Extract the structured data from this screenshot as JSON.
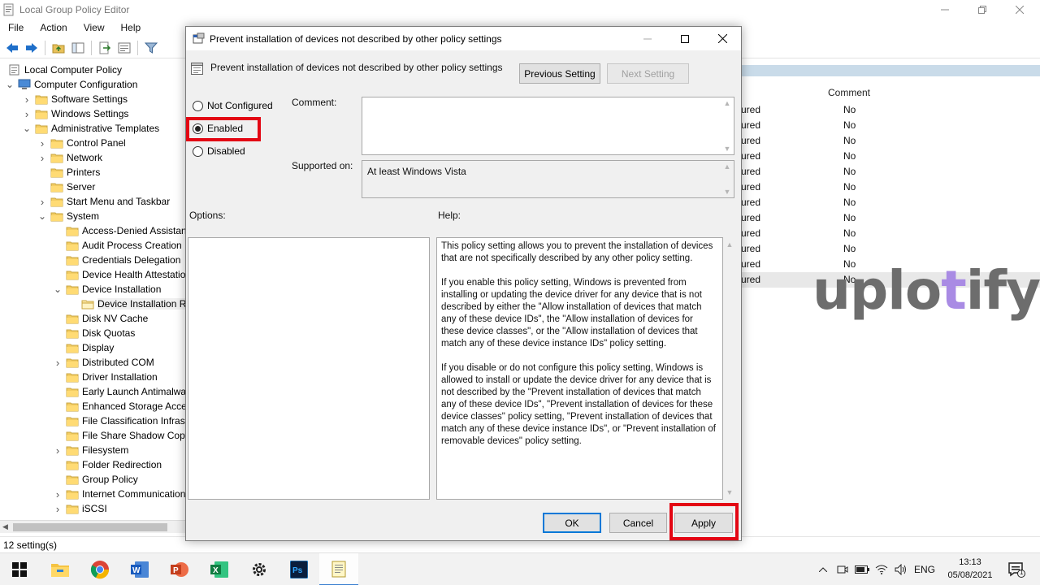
{
  "main": {
    "title": "Local Group Policy Editor",
    "menu": [
      "File",
      "Action",
      "View",
      "Help"
    ],
    "tree": [
      {
        "label": "Local Computer Policy",
        "level": 0,
        "expander": "",
        "folder": false
      },
      {
        "label": "Computer Configuration",
        "level": 0,
        "expander": "open",
        "folder": false
      },
      {
        "label": "Software Settings",
        "level": 1,
        "expander": "closed",
        "folder": true
      },
      {
        "label": "Windows Settings",
        "level": 1,
        "expander": "closed",
        "folder": true
      },
      {
        "label": "Administrative Templates",
        "level": 1,
        "expander": "open",
        "folder": true
      },
      {
        "label": "Control Panel",
        "level": 2,
        "expander": "closed",
        "folder": true
      },
      {
        "label": "Network",
        "level": 2,
        "expander": "closed",
        "folder": true
      },
      {
        "label": "Printers",
        "level": 2,
        "expander": "",
        "folder": true
      },
      {
        "label": "Server",
        "level": 2,
        "expander": "",
        "folder": true
      },
      {
        "label": "Start Menu and Taskbar",
        "level": 2,
        "expander": "closed",
        "folder": true
      },
      {
        "label": "System",
        "level": 2,
        "expander": "open",
        "folder": true
      },
      {
        "label": "Access-Denied Assistance",
        "level": 3,
        "expander": "",
        "folder": true
      },
      {
        "label": "Audit Process Creation",
        "level": 3,
        "expander": "",
        "folder": true
      },
      {
        "label": "Credentials Delegation",
        "level": 3,
        "expander": "",
        "folder": true
      },
      {
        "label": "Device Health Attestation Service",
        "level": 3,
        "expander": "",
        "folder": true
      },
      {
        "label": "Device Installation",
        "level": 3,
        "expander": "open",
        "folder": true
      },
      {
        "label": "Device Installation Restrictions",
        "level": 4,
        "expander": "",
        "folder": true,
        "selected": true
      },
      {
        "label": "Disk NV Cache",
        "level": 3,
        "expander": "",
        "folder": true
      },
      {
        "label": "Disk Quotas",
        "level": 3,
        "expander": "",
        "folder": true
      },
      {
        "label": "Display",
        "level": 3,
        "expander": "",
        "folder": true
      },
      {
        "label": "Distributed COM",
        "level": 3,
        "expander": "closed",
        "folder": true
      },
      {
        "label": "Driver Installation",
        "level": 3,
        "expander": "",
        "folder": true
      },
      {
        "label": "Early Launch Antimalware",
        "level": 3,
        "expander": "",
        "folder": true
      },
      {
        "label": "Enhanced Storage Access",
        "level": 3,
        "expander": "",
        "folder": true
      },
      {
        "label": "File Classification Infrastructure",
        "level": 3,
        "expander": "",
        "folder": true
      },
      {
        "label": "File Share Shadow Copy Provider",
        "level": 3,
        "expander": "",
        "folder": true
      },
      {
        "label": "Filesystem",
        "level": 3,
        "expander": "closed",
        "folder": true
      },
      {
        "label": "Folder Redirection",
        "level": 3,
        "expander": "",
        "folder": true
      },
      {
        "label": "Group Policy",
        "level": 3,
        "expander": "",
        "folder": true
      },
      {
        "label": "Internet Communication Management",
        "level": 3,
        "expander": "closed",
        "folder": true
      },
      {
        "label": "iSCSI",
        "level": 3,
        "expander": "closed",
        "folder": true
      }
    ],
    "list": {
      "comment_header": "Comment",
      "state_fragment": "ured",
      "comments": [
        "No",
        "No",
        "No",
        "No",
        "No",
        "No",
        "No",
        "No",
        "No",
        "No",
        "No",
        "No"
      ]
    },
    "status": "12 setting(s)"
  },
  "dialog": {
    "title": "Prevent installation of devices not described by other policy settings",
    "setting_name": "Prevent installation of devices not described by other policy settings",
    "prev_button": "Previous Setting",
    "next_button": "Next Setting",
    "radios": [
      {
        "label": "Not Configured",
        "checked": false
      },
      {
        "label": "Enabled",
        "checked": true
      },
      {
        "label": "Disabled",
        "checked": false
      }
    ],
    "comment_label": "Comment:",
    "comment_value": "",
    "supported_label": "Supported on:",
    "supported_value": "At least Windows Vista",
    "options_label": "Options:",
    "help_label": "Help:",
    "help_paragraphs": [
      "This policy setting allows you to prevent the installation of devices that are not specifically described by any other policy setting.",
      "If you enable this policy setting, Windows is prevented from installing or updating the device driver for any device that is not described by either the \"Allow installation of devices that match any of these device IDs\", the \"Allow installation of devices for these device classes\", or the \"Allow installation of devices that match any of these device instance IDs\" policy setting.",
      "If you disable or do not configure this policy setting, Windows is allowed to install or update the device driver for any device that is not described by the \"Prevent installation of devices that match any of these device IDs\", \"Prevent installation of devices for these device classes\" policy setting, \"Prevent installation of devices that match any of these device instance IDs\", or \"Prevent installation of removable devices\" policy setting."
    ],
    "ok_button": "OK",
    "cancel_button": "Cancel",
    "apply_button": "Apply"
  },
  "watermark": {
    "part1": "uplo",
    "part2": "t",
    "part3": "ify"
  },
  "taskbar": {
    "language": "ENG",
    "time": "13:13",
    "date": "05/08/2021",
    "notification_count": "1",
    "apps": [
      "file-explorer",
      "chrome",
      "word",
      "powerpoint",
      "excel",
      "settings",
      "photoshop",
      "notepad"
    ]
  },
  "colors": {
    "highlight": "#e30613",
    "accent": "#0078d7",
    "watermark_gray": "#6d6d6d",
    "watermark_purple": "#a98be4"
  }
}
